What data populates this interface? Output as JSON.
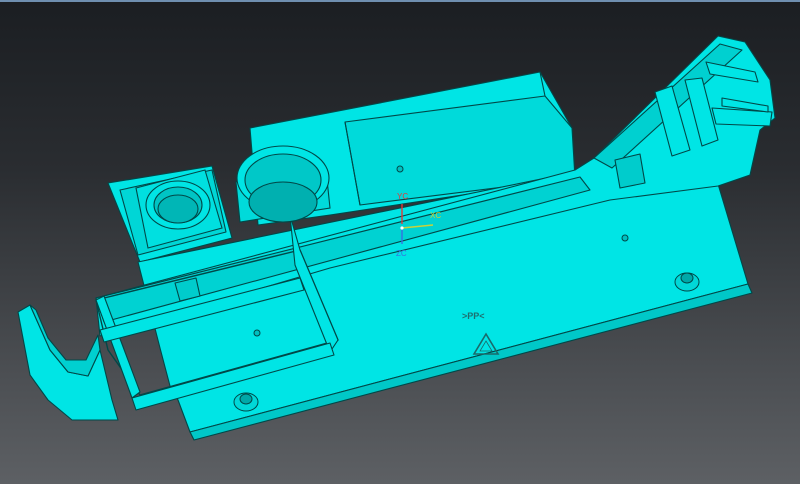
{
  "viewport": {
    "background_top": "#1b1e22",
    "background_bottom": "#5d6064",
    "model_color": "#00e5e5",
    "edge_color": "#004848"
  },
  "triad": {
    "y_label": "YC",
    "x_label": "XC",
    "z_label": "ZC",
    "y_color": "#e03a3a",
    "x_color": "#c8d23a",
    "z_color": "#3a6fe0"
  },
  "part": {
    "material_mark": ">PP<",
    "recycle_symbol": "recycle-triangle-icon"
  }
}
